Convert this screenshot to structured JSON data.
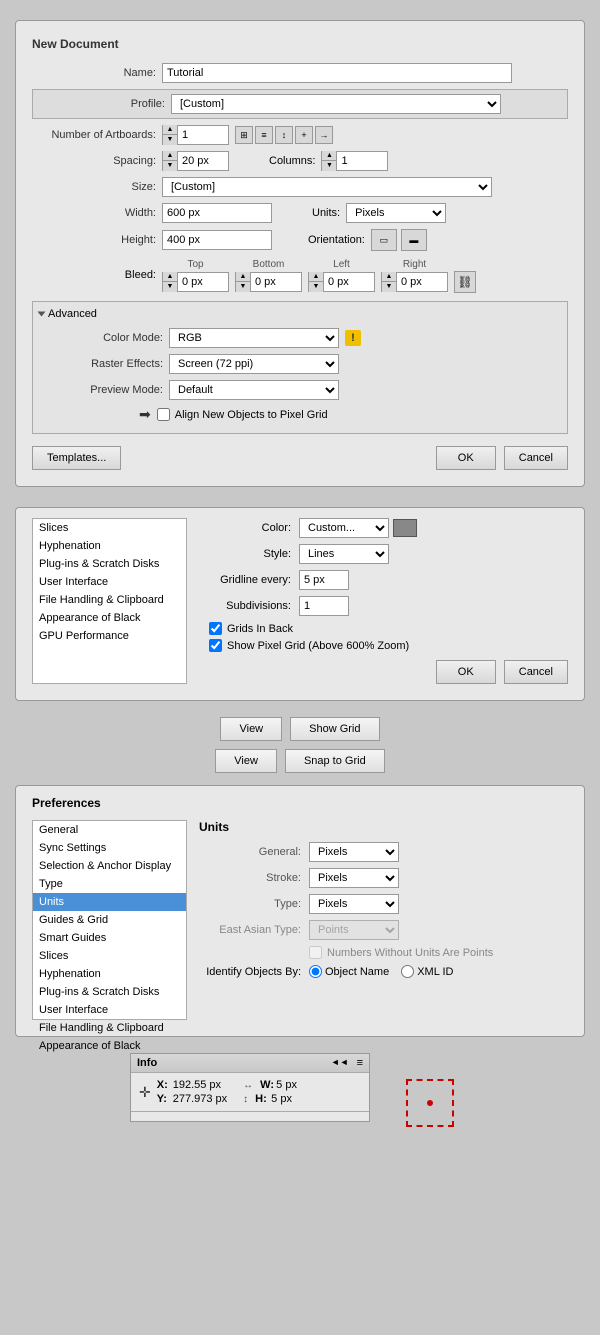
{
  "newDocument": {
    "title": "New Document",
    "name_label": "Name:",
    "name_value": "Tutorial",
    "profile_label": "Profile:",
    "profile_value": "[Custom]",
    "artboards_label": "Number of Artboards:",
    "artboards_value": "1",
    "spacing_label": "Spacing:",
    "spacing_value": "20 px",
    "columns_label": "Columns:",
    "columns_value": "1",
    "size_label": "Size:",
    "size_value": "[Custom]",
    "width_label": "Width:",
    "width_value": "600 px",
    "units_label": "Units:",
    "units_value": "Pixels",
    "height_label": "Height:",
    "height_value": "400 px",
    "orientation_label": "Orientation:",
    "bleed_label": "Bleed:",
    "bleed_top_label": "Top",
    "bleed_top_value": "0 px",
    "bleed_bottom_label": "Bottom",
    "bleed_bottom_value": "0 px",
    "bleed_left_label": "Left",
    "bleed_left_value": "0 px",
    "bleed_right_label": "Right",
    "bleed_right_value": "0 px",
    "advanced_label": "Advanced",
    "color_mode_label": "Color Mode:",
    "color_mode_value": "RGB",
    "raster_label": "Raster Effects:",
    "raster_value": "Screen (72 ppi)",
    "preview_label": "Preview Mode:",
    "preview_value": "Default",
    "align_checkbox_label": "Align New Objects to Pixel Grid",
    "templates_btn": "Templates...",
    "ok_btn": "OK",
    "cancel_btn": "Cancel"
  },
  "gridPrefs": {
    "sidebar_items": [
      "Slices",
      "Hyphenation",
      "Plug-ins & Scratch Disks",
      "User Interface",
      "File Handling & Clipboard",
      "Appearance of Black",
      "GPU Performance"
    ],
    "color_label": "Color:",
    "color_value": "Custom...",
    "style_label": "Style:",
    "style_value": "Lines",
    "gridline_label": "Gridline every:",
    "gridline_value": "5 px",
    "subdivisions_label": "Subdivisions:",
    "subdivisions_value": "1",
    "grids_in_back_label": "Grids In Back",
    "show_pixel_label": "Show Pixel Grid (Above 600% Zoom)",
    "ok_btn": "OK",
    "cancel_btn": "Cancel"
  },
  "viewButtons": {
    "view_label": "View",
    "show_grid_label": "Show Grid",
    "snap_grid_label": "Snap to Grid"
  },
  "preferences": {
    "title": "Preferences",
    "sidebar_items": [
      "General",
      "Sync Settings",
      "Selection & Anchor Display",
      "Type",
      {
        "label": "Units",
        "active": true
      },
      "Guides & Grid",
      "Smart Guides",
      "Slices",
      "Hyphenation",
      "Plug-ins & Scratch Disks",
      "User Interface",
      "File Handling & Clipboard",
      "Appearance of Black"
    ],
    "units_title": "Units",
    "general_label": "General:",
    "general_value": "Pixels",
    "stroke_label": "Stroke:",
    "stroke_value": "Pixels",
    "type_label": "Type:",
    "type_value": "Pixels",
    "east_asian_label": "East Asian Type:",
    "east_asian_value": "Points",
    "numbers_label": "Numbers Without Units Are Points",
    "identify_label": "Identify Objects By:",
    "object_name_label": "Object Name",
    "xml_id_label": "XML ID"
  },
  "infoPanel": {
    "title": "Info",
    "x_label": "X:",
    "x_value": "192.55 px",
    "y_label": "Y:",
    "y_value": "277.973 px",
    "w_label": "W:",
    "w_value": "5 px",
    "h_label": "H:",
    "h_value": "5 px",
    "collapse_icon": "◄◄",
    "menu_icon": "≡"
  }
}
